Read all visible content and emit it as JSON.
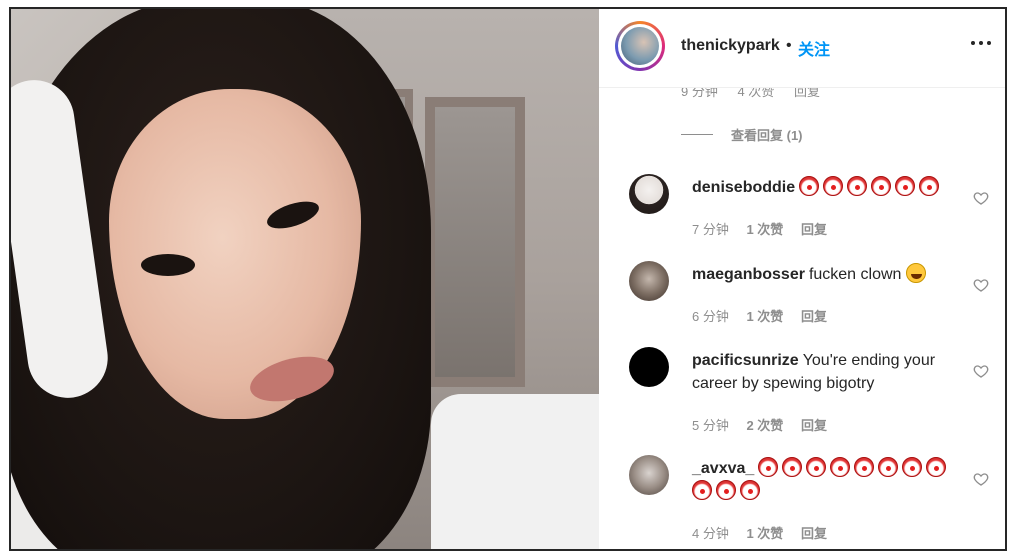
{
  "post": {
    "username": "thenickypark",
    "separator": "•",
    "follow_label": "关注",
    "more_icon": "more-horizontal-icon"
  },
  "cut_off_meta": {
    "time": "9 分钟",
    "likes": "4 次赞",
    "reply": "回复"
  },
  "view_replies": "查看回复 (1)",
  "comments": [
    {
      "username": "deniseboddie",
      "text": "",
      "emoji": "clown-face x6",
      "time": "7 分钟",
      "likes": "1 次赞",
      "reply": "回复"
    },
    {
      "username": "maeganbosser",
      "text": "fucken clown",
      "emoji": "face-with-tears-of-joy",
      "time": "6 分钟",
      "likes": "1 次赞",
      "reply": "回复"
    },
    {
      "username": "pacificsunrize",
      "text": "You're ending your career by spewing bigotry",
      "time": "5 分钟",
      "likes": "2 次赞",
      "reply": "回复"
    },
    {
      "username": "_avxva_",
      "text": "",
      "emoji": "clown-face x11",
      "time": "4 分钟",
      "likes": "1 次赞",
      "reply": "回复"
    }
  ],
  "colors": {
    "link_blue": "#0095f6",
    "text": "#262626",
    "meta": "#8e8e8e"
  }
}
